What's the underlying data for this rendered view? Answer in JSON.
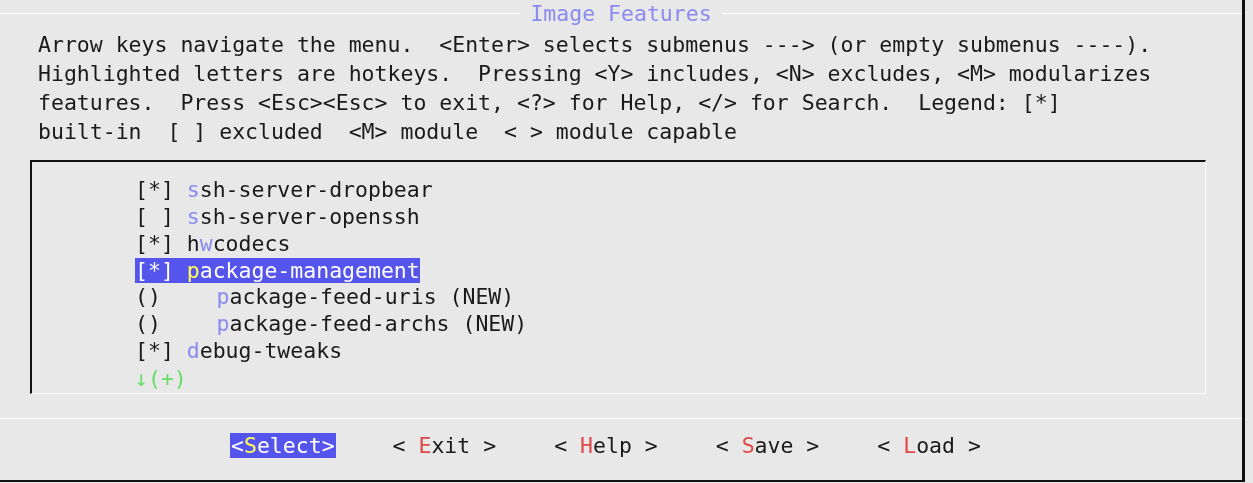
{
  "dialog": {
    "title": "Image Features"
  },
  "help_text": [
    "Arrow keys navigate the menu.  <Enter> selects submenus ---> (or empty submenus ----).",
    "Highlighted letters are hotkeys.  Pressing <Y> includes, <N> excludes, <M> modularizes",
    "features.  Press <Esc><Esc> to exit, <?> for Help, </> for Search.  Legend: [*]",
    "built-in  [ ] excluded  <M> module  < > module capable"
  ],
  "menu_items": [
    {
      "box": "[*]",
      "hotkey": "s",
      "rest": "sh-server-dropbear",
      "selected": false
    },
    {
      "box": "[ ]",
      "hotkey": "s",
      "rest": "sh-server-openssh",
      "selected": false
    },
    {
      "box": "[*]",
      "pre": "h",
      "hotkey": "w",
      "rest": "codecs",
      "selected": false
    },
    {
      "box": "[*]",
      "hotkey": "p",
      "rest": "ackage-management",
      "selected": true,
      "children": [
        {
          "box": "()",
          "hotkey": "p",
          "rest": "ackage-feed-uris (NEW)",
          "selected": false
        },
        {
          "box": "()",
          "hotkey": "p",
          "rest": "ackage-feed-archs (NEW)",
          "selected": false
        }
      ]
    },
    {
      "box": "[*]",
      "hotkey": "d",
      "rest": "ebug-tweaks",
      "selected": false
    }
  ],
  "more_indicator": "↓(+)",
  "buttons": [
    {
      "pre": "<",
      "hotkey": "S",
      "rest": "elect>",
      "selected": true
    },
    {
      "pre": "< ",
      "hotkey": "E",
      "rest": "xit >",
      "selected": false
    },
    {
      "pre": "< ",
      "hotkey": "H",
      "rest": "elp >",
      "selected": false
    },
    {
      "pre": "< ",
      "hotkey": "S",
      "rest": "ave >",
      "selected": false
    },
    {
      "pre": "< ",
      "hotkey": "L",
      "rest": "oad >",
      "selected": false
    }
  ]
}
